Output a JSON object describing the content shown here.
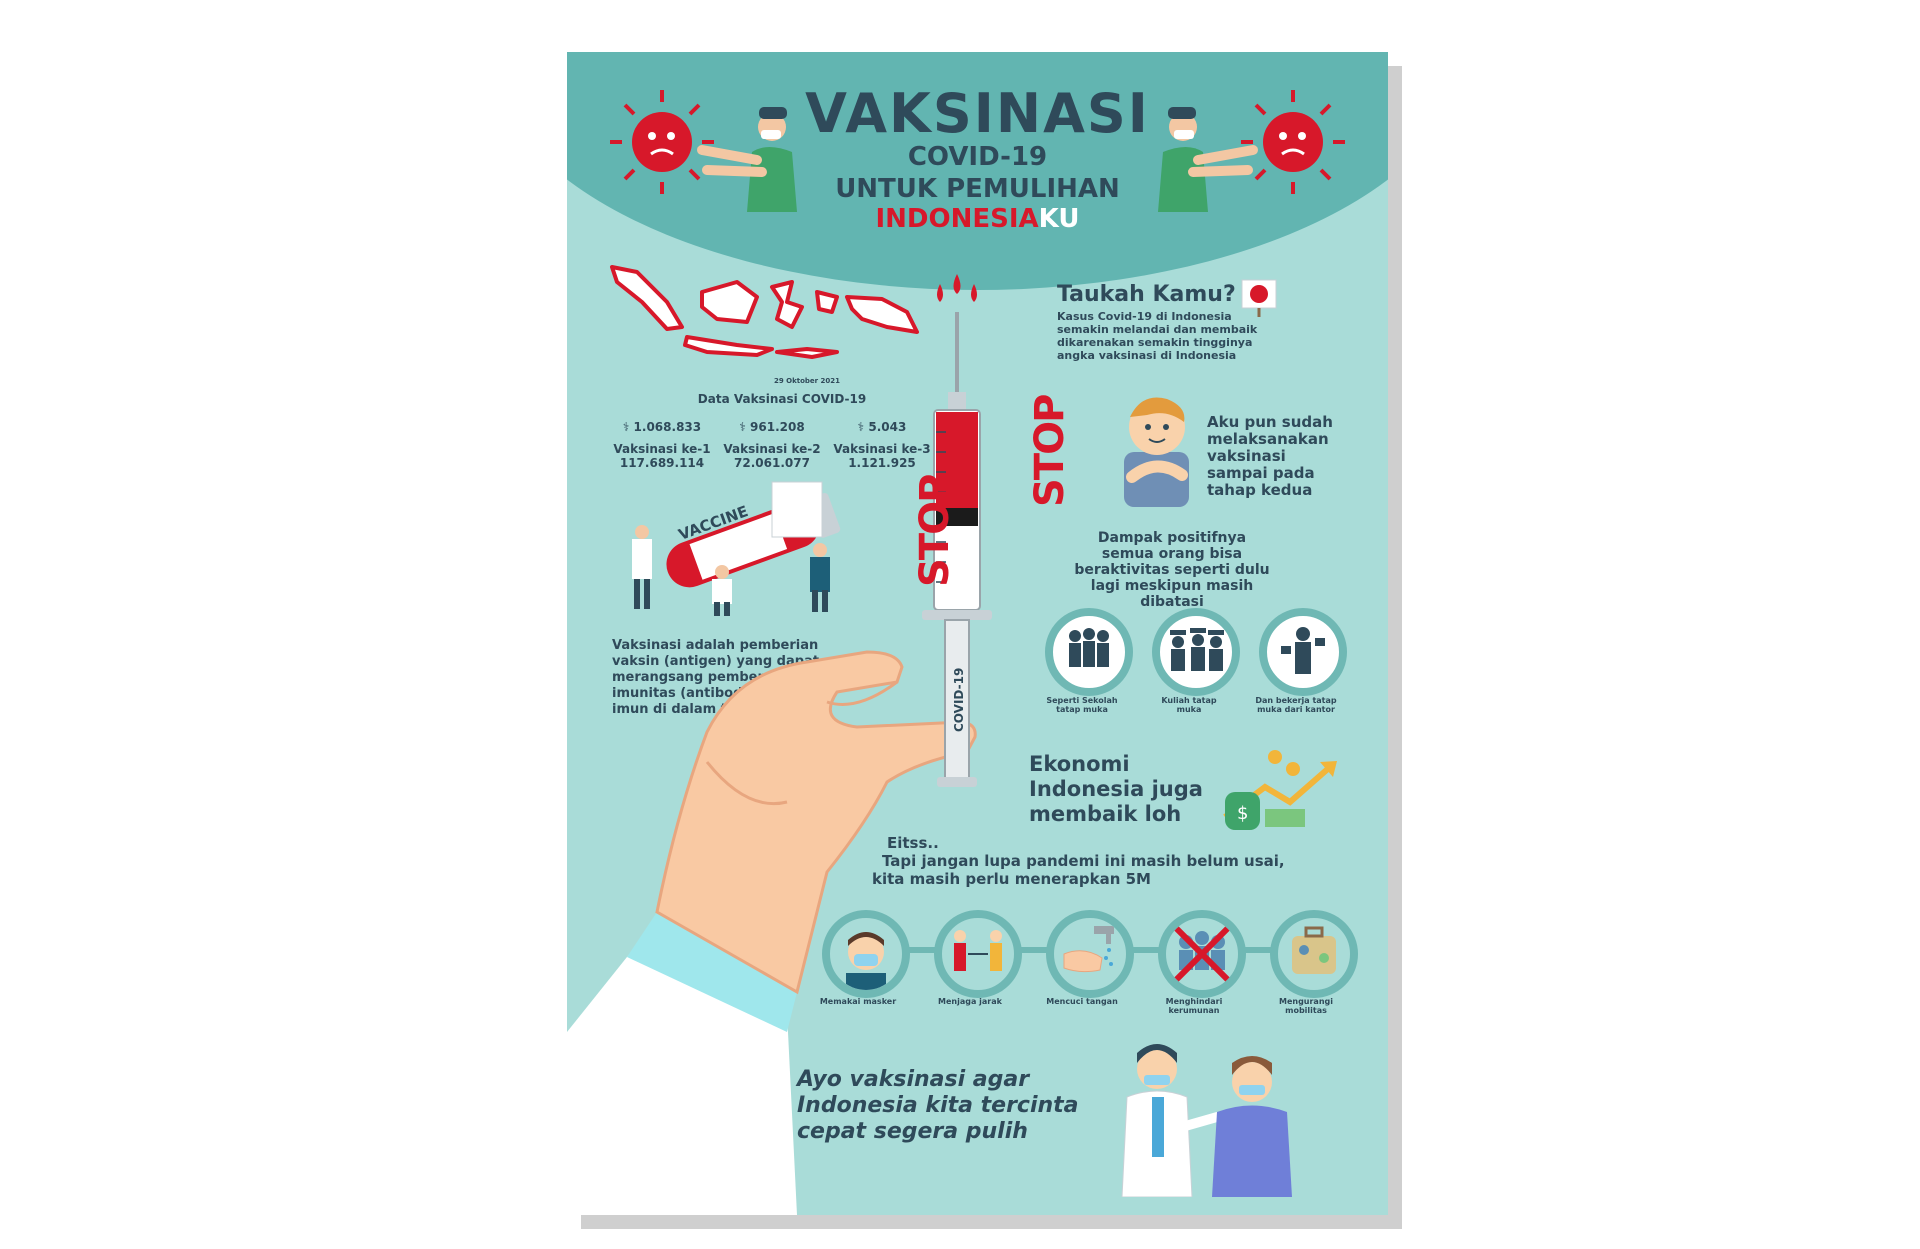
{
  "header": {
    "title_line1": "VAKSINASI",
    "title_line2": "COVID-19",
    "title_line3": "UNTUK PEMULIHAN",
    "title_line4_red": "INDONESIA",
    "title_line4_white": "KU"
  },
  "vaccination_data": {
    "date": "29 Oktober 2021",
    "heading": "Data Vaksinasi COVID-19",
    "stats": [
      {
        "top": "1.068.833",
        "label": "Vaksinasi ke-1",
        "value": "117.689.114"
      },
      {
        "top": "961.208",
        "label": "Vaksinasi ke-2",
        "value": "72.061.077"
      },
      {
        "top": "5.043",
        "label": "Vaksinasi ke-3",
        "value": "1.121.925"
      }
    ]
  },
  "vaccine_label": "VACCINE",
  "syringe_label": "COVID-19",
  "stop_label": "STOP",
  "definition": "Vaksinasi adalah pemberian vaksin (antigen) yang dapat merangsang pembentukan imunitas (antibodi) sistem imun di dalam tubuh",
  "did_you_know": {
    "title": "Taukah Kamu?",
    "body": "Kasus Covid-19 di Indonesia semakin melandai dan membaik dikarenakan semakin tingginya angka vaksinasi di Indonesia"
  },
  "already_vaccinated": "Aku pun sudah melaksanakan vaksinasi sampai pada tahap kedua",
  "positive_impact": "Dampak positifnya semua orang bisa beraktivitas seperti dulu lagi meskipun masih dibatasi",
  "activities": [
    {
      "label": "Seperti Sekolah tatap muka"
    },
    {
      "label": "Kuliah tatap muka"
    },
    {
      "label": "Dan bekerja tatap muka dari kantor"
    }
  ],
  "economy": "Ekonomi Indonesia juga membaik loh",
  "reminder": {
    "line1": "Eitss..",
    "line2": "Tapi jangan lupa pandemi ini masih belum usai,",
    "line3": "kita masih perlu menerapkan 5M"
  },
  "five_m": [
    {
      "label": "Memakai masker"
    },
    {
      "label": "Menjaga jarak"
    },
    {
      "label": "Mencuci tangan"
    },
    {
      "label": "Menghindari kerumunan"
    },
    {
      "label": "Mengurangi mobilitas"
    }
  ],
  "closing": "Ayo vaksinasi agar Indonesia kita tercinta cepat segera pulih",
  "colors": {
    "background": "#a9dcd8",
    "header": "#62b5b1",
    "text": "#2f4a5a",
    "red": "#d7182a"
  }
}
